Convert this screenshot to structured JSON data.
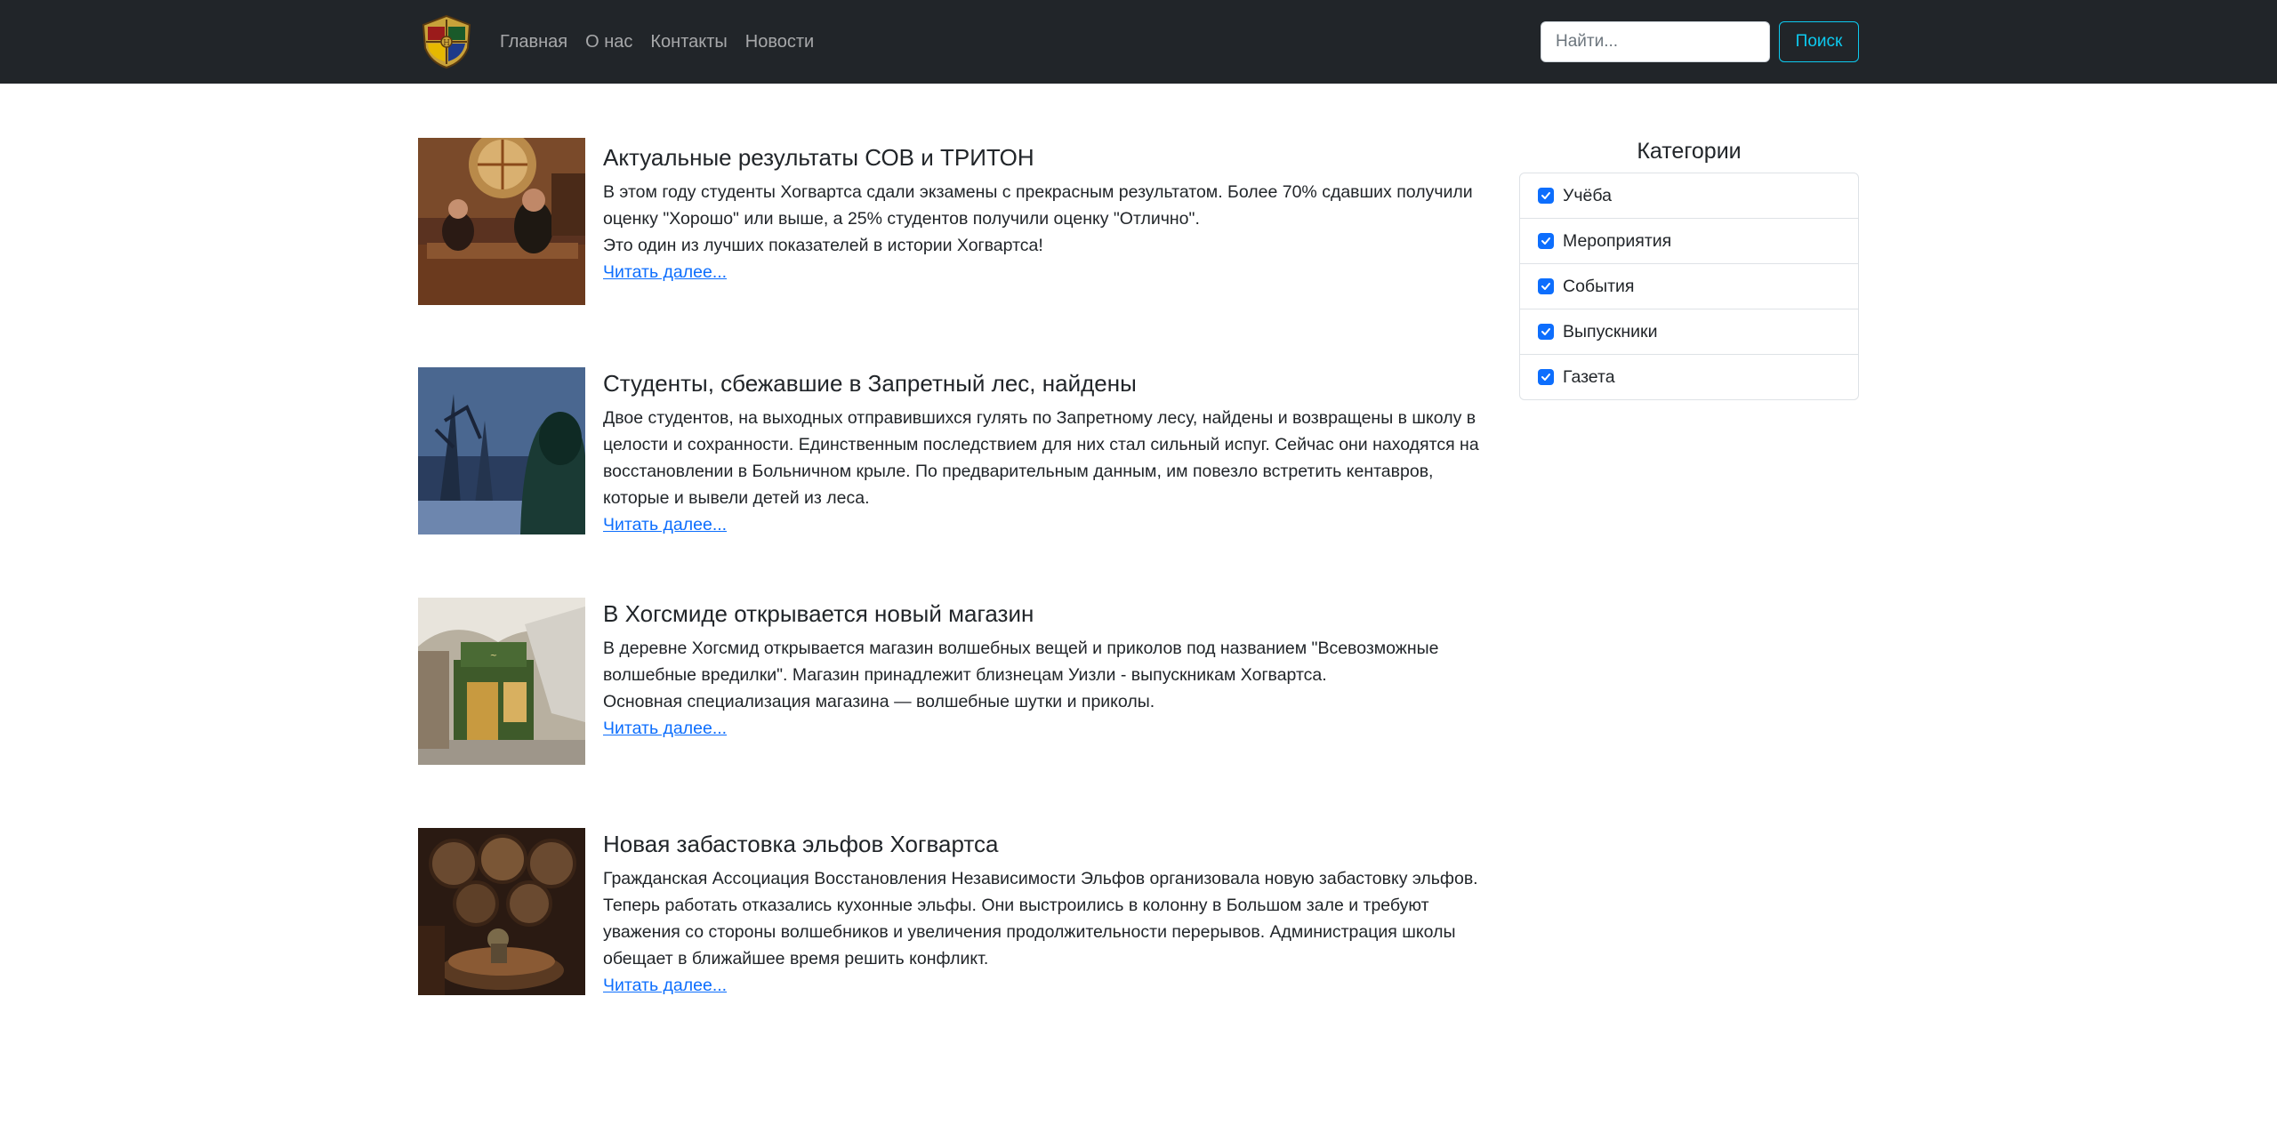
{
  "colors": {
    "navbar_bg": "#212529",
    "link": "#0d6efd",
    "search_button": "#0dcaf0",
    "checkbox": "#0d6efd"
  },
  "navbar": {
    "logo_icon": "hogwarts-crest-icon",
    "links": [
      "Главная",
      "О нас",
      "Контакты",
      "Новости"
    ],
    "search_placeholder": "Найти...",
    "search_button": "Поиск"
  },
  "articles": [
    {
      "title": "Актуальные результаты СОВ и ТРИТОН",
      "paragraphs": [
        "В этом году студенты Хогвартса сдали экзамены с прекрасным результатом. Более 70% сдавших получили оценку \"Хорошо\" или выше, а 25% студентов получили оценку \"Отлично\".",
        "Это один из лучших показателей в истории Хогвартса!"
      ],
      "read_more": "Читать далее..."
    },
    {
      "title": "Студенты, сбежавшие в Запретный лес, найдены",
      "paragraphs": [
        "Двое студентов, на выходных отправившихся гулять по Запретному лесу, найдены и возвращены в школу в целости и сохранности. Единственным последствием для них стал сильный испуг. Сейчас они находятся на восстановлении в Больничном крыле. По предварительным данным, им повезло встретить кентавров, которые и вывели детей из леса."
      ],
      "read_more": "Читать далее..."
    },
    {
      "title": "В Хогсмиде открывается новый магазин",
      "paragraphs": [
        "В деревне Хогсмид открывается магазин волшебных вещей и приколов под названием \"Всевозможные волшебные вредилки\". Магазин принадлежит близнецам Уизли - выпускникам Хогвартса.",
        "Основная специализация магазина — волшебные шутки и приколы."
      ],
      "read_more": "Читать далее..."
    },
    {
      "title": "Новая забастовка эльфов Хогвартса",
      "paragraphs": [
        "Гражданская Ассоциация Восстановления Независимости Эльфов организовала новую забастовку эльфов. Теперь работать отказались кухонные эльфы. Они выстроились в колонну в Большом зале и требуют уважения со стороны волшебников и увеличения продолжительности перерывов. Администрация школы обещает в ближайшее время решить конфликт."
      ],
      "read_more": "Читать далее..."
    }
  ],
  "sidebar": {
    "title": "Категории",
    "categories": [
      {
        "label": "Учёба",
        "checked": true
      },
      {
        "label": "Мероприятия",
        "checked": true
      },
      {
        "label": "События",
        "checked": true
      },
      {
        "label": "Выпускники",
        "checked": true
      },
      {
        "label": "Газета",
        "checked": true
      }
    ]
  }
}
